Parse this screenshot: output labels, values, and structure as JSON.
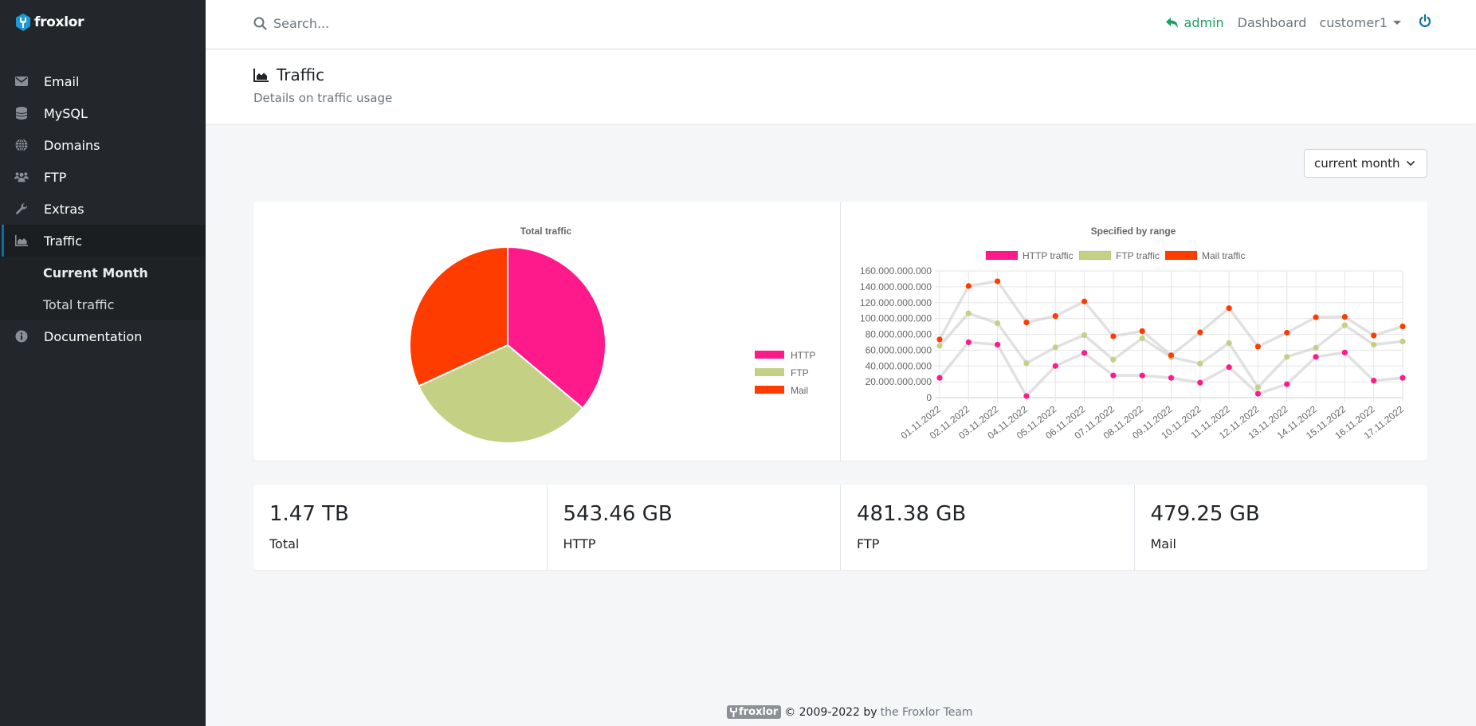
{
  "brand": {
    "name": "froxlor"
  },
  "sidebar": {
    "items": [
      {
        "label": "Email",
        "icon": "envelope-icon"
      },
      {
        "label": "MySQL",
        "icon": "database-icon"
      },
      {
        "label": "Domains",
        "icon": "globe-icon"
      },
      {
        "label": "FTP",
        "icon": "users-icon"
      },
      {
        "label": "Extras",
        "icon": "wrench-icon"
      },
      {
        "label": "Traffic",
        "icon": "chart-area-icon",
        "active": true
      },
      {
        "label": "Documentation",
        "icon": "info-circle-icon"
      }
    ],
    "traffic_sub": [
      {
        "label": "Current Month",
        "current": true
      },
      {
        "label": "Total traffic"
      }
    ]
  },
  "topbar": {
    "search_placeholder": "Search...",
    "admin_label": "admin",
    "dashboard_label": "Dashboard",
    "user_label": "customer1"
  },
  "page": {
    "title": "Traffic",
    "subtitle": "Details on traffic usage"
  },
  "range_select": {
    "selected": "current month"
  },
  "stats": [
    {
      "value": "1.47 TB",
      "label": "Total"
    },
    {
      "value": "543.46 GB",
      "label": "HTTP"
    },
    {
      "value": "481.38 GB",
      "label": "FTP"
    },
    {
      "value": "479.25 GB",
      "label": "Mail"
    }
  ],
  "footer": {
    "badge": "froxlor",
    "copyright": "© 2009-2022 by",
    "team_link": "the Froxlor Team"
  },
  "colors": {
    "http": "#ff1a8c",
    "ftp": "#c4d084",
    "mail": "#ff3c00",
    "accent": "#0d6ea8",
    "admin_green": "#1aa060"
  },
  "chart_data": [
    {
      "type": "pie",
      "title": "Total traffic",
      "categories": [
        "HTTP",
        "FTP",
        "Mail"
      ],
      "values": [
        543.46,
        481.38,
        479.25
      ],
      "unit": "GB",
      "legend": "right"
    },
    {
      "type": "line",
      "title": "Specified by range",
      "x": [
        "01.11.2022",
        "02.11.2022",
        "03.11.2022",
        "04.11.2022",
        "05.11.2022",
        "06.11.2022",
        "07.11.2022",
        "08.11.2022",
        "09.11.2022",
        "10.11.2022",
        "11.11.2022",
        "12.11.2022",
        "13.11.2022",
        "14.11.2022",
        "15.11.2022",
        "16.11.2022",
        "17.11.2022"
      ],
      "series": [
        {
          "name": "HTTP traffic",
          "values": [
            25000000000,
            70000000000,
            67000000000,
            2000000000,
            40000000000,
            56500000000,
            28000000000,
            28000000000,
            25000000000,
            19000000000,
            38500000000,
            5000000000,
            17000000000,
            51500000000,
            57000000000,
            21500000000,
            25000000000
          ]
        },
        {
          "name": "FTP traffic",
          "values": [
            65500000000,
            106500000000,
            94000000000,
            43500000000,
            63500000000,
            79000000000,
            48000000000,
            75000000000,
            51000000000,
            43000000000,
            69000000000,
            13000000000,
            51500000000,
            63000000000,
            91500000000,
            67000000000,
            71000000000
          ]
        },
        {
          "name": "Mail traffic",
          "values": [
            73500000000,
            141000000000,
            147000000000,
            95000000000,
            103000000000,
            121500000000,
            77500000000,
            84000000000,
            53500000000,
            82500000000,
            113000000000,
            64500000000,
            82000000000,
            101500000000,
            102000000000,
            78500000000,
            90000000000
          ]
        }
      ],
      "yticks": [
        "0",
        "20.000.000.000",
        "40.000.000.000",
        "60.000.000.000",
        "80.000.000.000",
        "100.000.000.000",
        "120.000.000.000",
        "140.000.000.000",
        "160.000.000.000"
      ],
      "ylim": [
        0,
        160000000000
      ],
      "legend": "top",
      "grid": true
    }
  ]
}
